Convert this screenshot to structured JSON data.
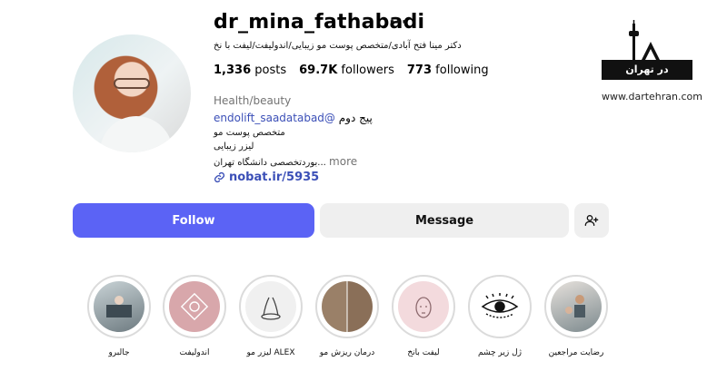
{
  "profile": {
    "username": "dr_mina_fathabadi",
    "more_icon": "ellipsis-icon",
    "full_name": "دکتر مینا فتح آبادی/متخصص پوست مو زیبایی/اندولیفت/لیفت با نخ",
    "stats": {
      "posts_value": "1,336",
      "posts_label": "posts",
      "followers_value": "69.7K",
      "followers_label": "followers",
      "following_value": "773",
      "following_label": "following"
    },
    "category": "Health/beauty",
    "mention": "endolift_saadatabad@",
    "mention_prefix": "پیج دوم",
    "bio_lines": [
      "متخصص پوست مو",
      "لیزر زیبایی",
      "بوردتخصصی دانشگاه تهران..."
    ],
    "more_label": "more",
    "link": "nobat.ir/5935"
  },
  "logo": {
    "title": "در تهران",
    "url": "www.dartehran.com"
  },
  "actions": {
    "follow": "Follow",
    "message": "Message",
    "adduser_icon": "add-person-icon"
  },
  "highlights": [
    {
      "label": "جالبرو"
    },
    {
      "label": "اندولیفت"
    },
    {
      "label": "لیزر مو ALEX"
    },
    {
      "label": "درمان ریزش مو"
    },
    {
      "label": "لیفت بانخ"
    },
    {
      "label": "ژل زیر چشم"
    },
    {
      "label": "رضایت مراجعین"
    }
  ],
  "colors": {
    "follow_button": "#5b63f5",
    "link": "#3b4fb7",
    "secondary_button": "#efefef"
  }
}
